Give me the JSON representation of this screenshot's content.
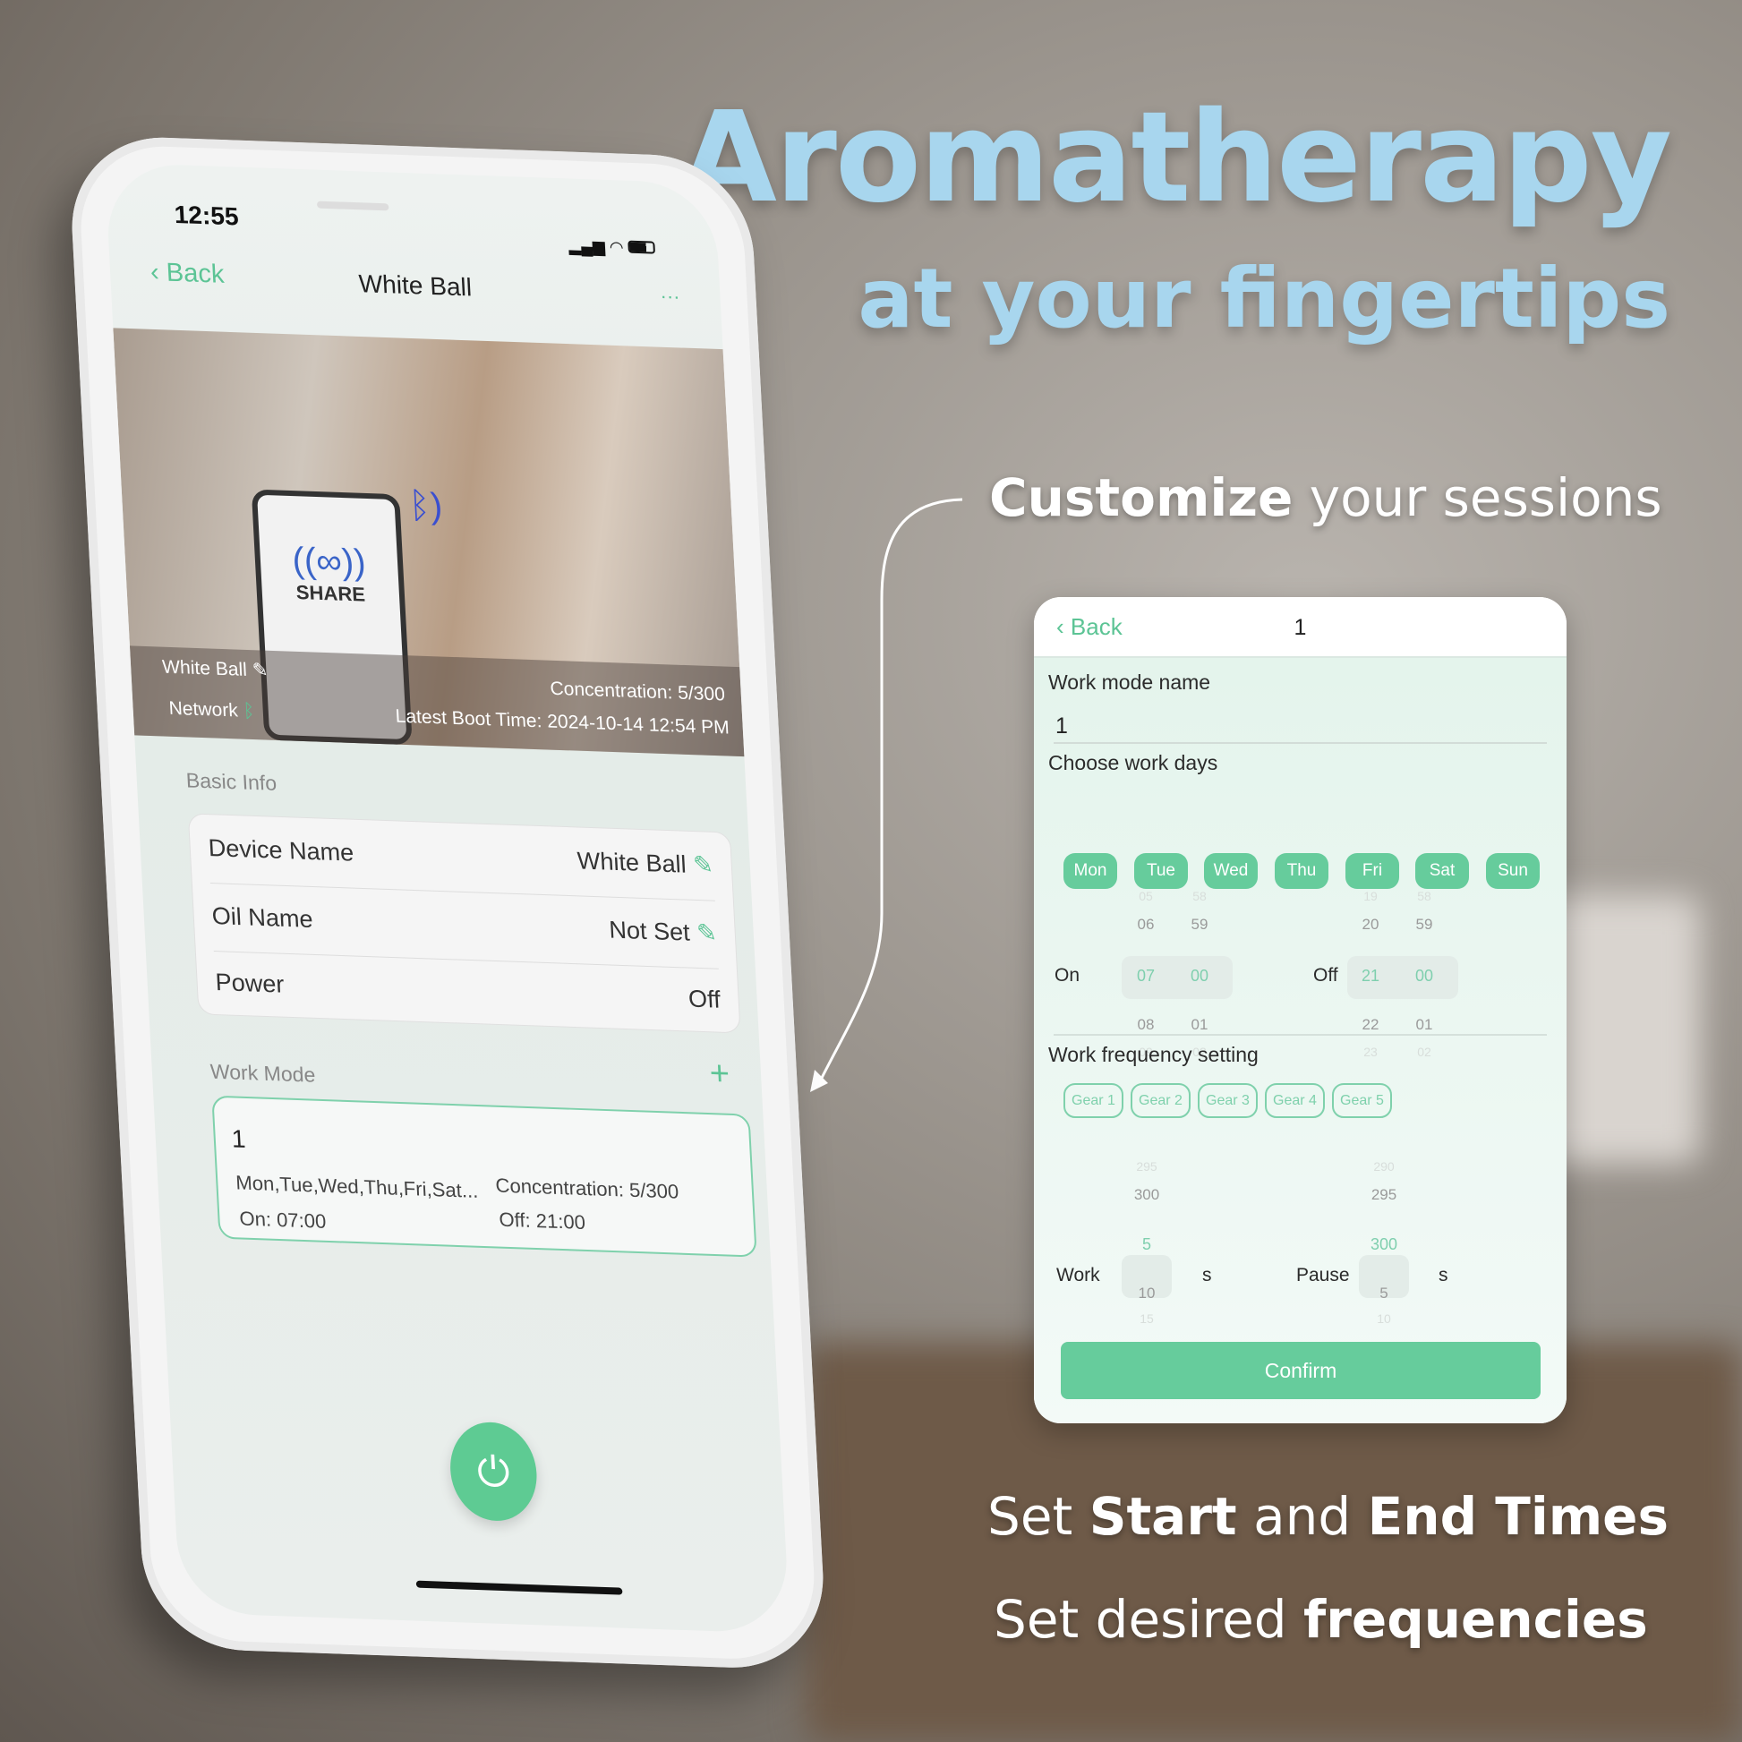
{
  "headline": {
    "line1": "Aromatherapy",
    "line2": "at your fingertips"
  },
  "callouts": {
    "customize_bold": "Customize",
    "customize_rest": " your sessions",
    "times_1": "Set ",
    "times_2": "Start",
    "times_3": " and ",
    "times_4": "End Times",
    "freq_1": "Set desired ",
    "freq_2": "frequencies"
  },
  "phone": {
    "status": {
      "time": "12:55"
    },
    "nav": {
      "back": "Back",
      "title": "White Ball",
      "more": "···"
    },
    "photo": {
      "logo_text": "SHARE",
      "device_name": "White Ball",
      "network": "Network",
      "concentration": "Concentration: 5/300",
      "boot_time": "Latest Boot Time: 2024-10-14 12:54 PM"
    },
    "basic_info": {
      "title": "Basic Info",
      "rows": [
        {
          "label": "Device Name",
          "value": "White Ball"
        },
        {
          "label": "Oil Name",
          "value": "Not Set"
        },
        {
          "label": "Power",
          "value": "Off"
        }
      ]
    },
    "work_mode": {
      "title": "Work Mode",
      "add": "+",
      "card": {
        "name": "1",
        "days": "Mon,Tue,Wed,Thu,Fri,Sat...",
        "concentration": "Concentration: 5/300",
        "on": "On: 07:00",
        "off": "Off: 21:00"
      }
    }
  },
  "panel": {
    "back": "Back",
    "title": "1",
    "name_label": "Work mode name",
    "name_value": "1",
    "days_label": "Choose work days",
    "days": [
      "Mon",
      "Tue",
      "Wed",
      "Thu",
      "Fri",
      "Sat",
      "Sun"
    ],
    "on_label": "On",
    "off_label": "Off",
    "on_hours": [
      "05",
      "06",
      "07",
      "08",
      "09"
    ],
    "on_minutes": [
      "58",
      "59",
      "00",
      "01",
      "02"
    ],
    "off_hours": [
      "19",
      "20",
      "21",
      "22",
      "23"
    ],
    "off_minutes": [
      "58",
      "59",
      "00",
      "01",
      "02"
    ],
    "freq_label": "Work frequency setting",
    "gears": [
      "Gear 1",
      "Gear 2",
      "Gear 3",
      "Gear 4",
      "Gear 5"
    ],
    "work_label": "Work",
    "pause_label": "Pause",
    "unit": "s",
    "work_values": [
      "295",
      "300",
      "5",
      "10",
      "15"
    ],
    "pause_values": [
      "290",
      "295",
      "300",
      "5",
      "10"
    ],
    "confirm": "Confirm"
  },
  "colors": {
    "accent": "#66cc9c",
    "headline": "#a8d6ee"
  }
}
